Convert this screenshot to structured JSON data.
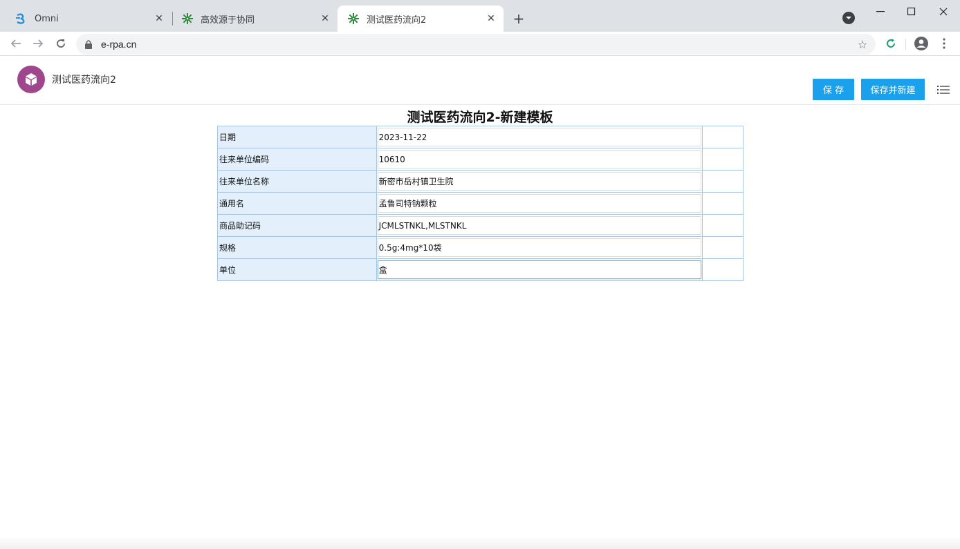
{
  "browser": {
    "tabs": [
      {
        "title": "Omni",
        "icon": "omni-logo-icon",
        "active": false
      },
      {
        "title": "高效源于协同",
        "icon": "gear-flower-icon",
        "active": false
      },
      {
        "title": "测试医药流向2",
        "icon": "gear-flower-icon",
        "active": true
      }
    ],
    "url": "e-rpa.cn",
    "colors": {
      "tabstrip": "#dee1e6",
      "omnibox": "#f1f3f4"
    }
  },
  "app": {
    "name": "测试医药流向2",
    "logo_icon": "cube-icon",
    "logo_color": "#a0468c",
    "buttons": {
      "save": "保 存",
      "save_new": "保存并新建"
    },
    "button_color": "#1ba1ec"
  },
  "form": {
    "title": "测试医药流向2-新建模板",
    "rows": [
      {
        "label": "日期",
        "value": "2023-11-22"
      },
      {
        "label": "往来单位编码",
        "value": "10610"
      },
      {
        "label": "往来单位名称",
        "value": "新密市岳村镇卫生院"
      },
      {
        "label": "通用名",
        "value": "孟鲁司特钠颗粒"
      },
      {
        "label": "商品助记码",
        "value": "JCMLSTNKL,MLSTNKL"
      },
      {
        "label": "规格",
        "value": "0.5g:4mg*10袋"
      },
      {
        "label": "单位",
        "value": "盒"
      }
    ]
  }
}
